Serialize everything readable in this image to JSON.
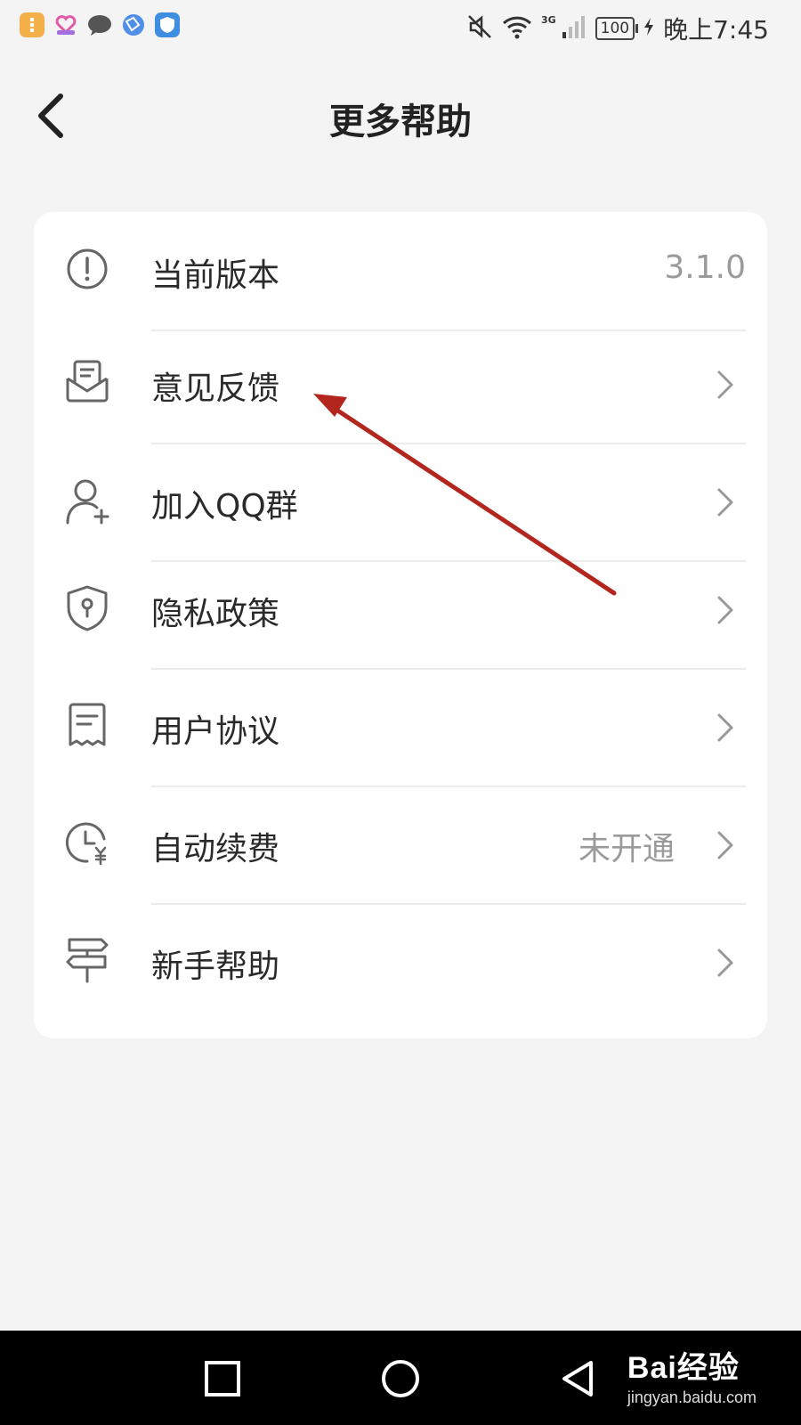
{
  "status_bar": {
    "time": "晚上7:45",
    "battery": "100",
    "network": "3G"
  },
  "header": {
    "title": "更多帮助"
  },
  "menu": [
    {
      "icon": "info-circle-icon",
      "label": "当前版本",
      "value": "3.1.0",
      "has_chevron": false
    },
    {
      "icon": "feedback-envelope-icon",
      "label": "意见反馈",
      "value": "",
      "has_chevron": true
    },
    {
      "icon": "add-user-icon",
      "label": "加入QQ群",
      "value": "",
      "has_chevron": true
    },
    {
      "icon": "shield-lock-icon",
      "label": "隐私政策",
      "value": "",
      "has_chevron": true
    },
    {
      "icon": "document-icon",
      "label": "用户协议",
      "value": "",
      "has_chevron": true
    },
    {
      "icon": "clock-yen-icon",
      "label": "自动续费",
      "value": "未开通",
      "has_chevron": true
    },
    {
      "icon": "signpost-icon",
      "label": "新手帮助",
      "value": "",
      "has_chevron": true
    }
  ],
  "watermark": {
    "brand": "Bai经验",
    "url": "jingyan.baidu.com"
  },
  "colors": {
    "background": "#f4f4f5",
    "card": "#ffffff",
    "annotation_arrow": "#b3261e",
    "icon_stroke": "#666666",
    "muted_text": "#9a9a9a"
  }
}
